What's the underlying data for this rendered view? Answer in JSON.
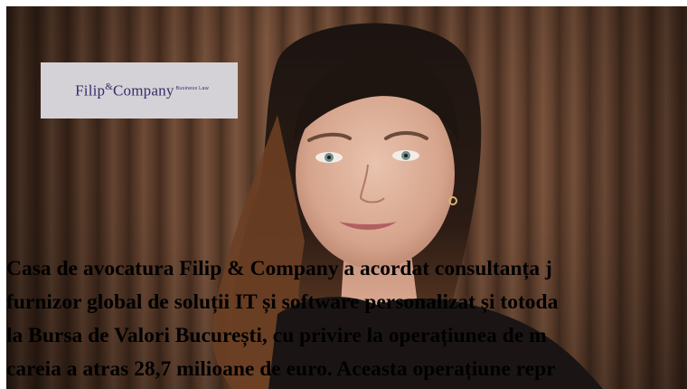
{
  "logo": {
    "brand": "Filip",
    "amp": "&",
    "brand2": "Company",
    "tagline": "Business Law"
  },
  "caption": {
    "lines": [
      "Casa de avocatura Filip & Company a acordat consultanța j",
      "furnizor global de soluții IT și software personalizat și totoda",
      "la Bursa de Valori București, cu privire la operațiunea de m",
      "careia a atras 28,7 milioane de euro. Aceasta operațiune repr"
    ]
  },
  "colors": {
    "logo_text": "#3b2a6d",
    "logo_bg": "#d4d2d6",
    "background": "#5c3b29"
  }
}
